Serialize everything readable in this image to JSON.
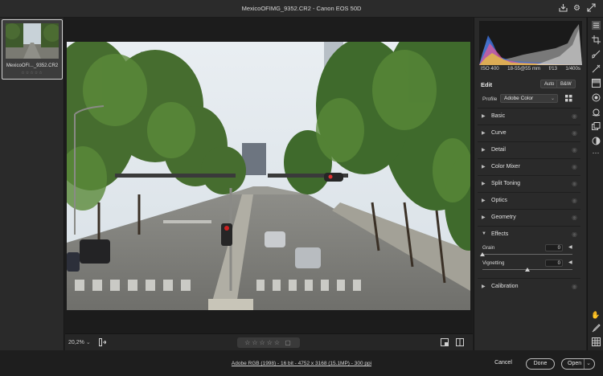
{
  "window": {
    "title": "MexicoOFIMG_9352.CR2  -  Canon EOS 50D"
  },
  "titlebar_icons": [
    "save-icon",
    "gear-icon",
    "expand-icon"
  ],
  "filmstrip": {
    "thumbnail_name": "MexicoOFI..._9352.CR2",
    "stars": "☆☆☆☆☆"
  },
  "image_meta": {
    "iso": "ISO 400",
    "lens": "18-55@55 mm",
    "aperture": "f/13",
    "shutter": "1/400s"
  },
  "edit": {
    "heading": "Edit",
    "auto_label": "Auto",
    "bw_label": "B&W",
    "profile_label": "Profile",
    "profile_value": "Adobe Color"
  },
  "sections": [
    {
      "label": "Basic",
      "expanded": false
    },
    {
      "label": "Curve",
      "expanded": false
    },
    {
      "label": "Detail",
      "expanded": false
    },
    {
      "label": "Color Mixer",
      "expanded": false
    },
    {
      "label": "Split Toning",
      "expanded": false
    },
    {
      "label": "Optics",
      "expanded": false
    },
    {
      "label": "Geometry",
      "expanded": false
    },
    {
      "label": "Effects",
      "expanded": true
    },
    {
      "label": "Calibration",
      "expanded": false
    }
  ],
  "effects": {
    "grain": {
      "label": "Grain",
      "value": "0",
      "level": 0
    },
    "vignetting": {
      "label": "Vignetting",
      "value": "0",
      "level": 0.5
    }
  },
  "bottombar": {
    "zoom": "20,2%",
    "zoom_chevron": "⌄",
    "rating": "☆☆☆☆☆ ▢"
  },
  "footer": {
    "info": "Adobe RGB (1998) - 16 bit - 4752 x 3168 (15.1MP) - 300 ppi",
    "cancel": "Cancel",
    "done": "Done",
    "open": "Open"
  },
  "tools": [
    "sliders-icon",
    "crop-icon",
    "brush-icon",
    "gradient-icon",
    "radial-icon",
    "redeye-icon",
    "presets-icon",
    "snapshot-icon",
    "more-icon",
    "hand-icon",
    "color-sampler-icon",
    "grid-icon"
  ]
}
